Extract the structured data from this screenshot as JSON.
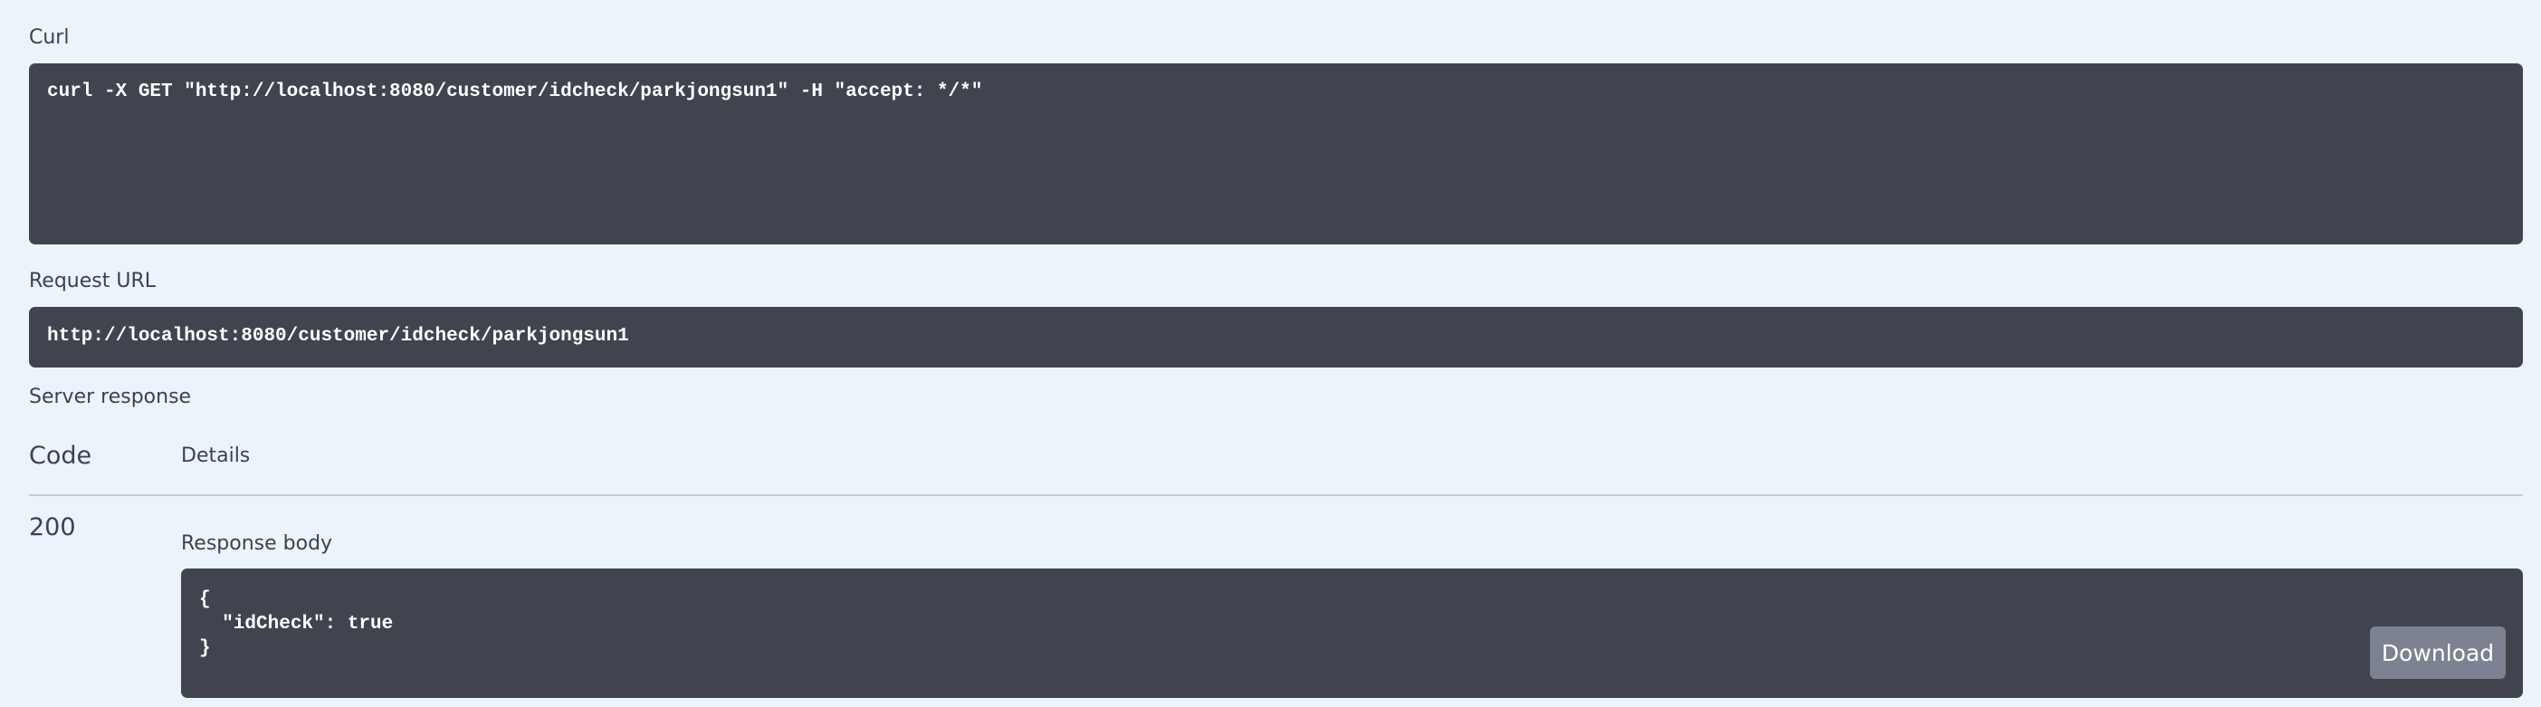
{
  "curl": {
    "label": "Curl",
    "command": "curl -X GET \"http://localhost:8080/customer/idcheck/parkjongsun1\" -H \"accept: */*\""
  },
  "request_url": {
    "label": "Request URL",
    "value": "http://localhost:8080/customer/idcheck/parkjongsun1"
  },
  "server_response": {
    "label": "Server response",
    "columns": {
      "code": "Code",
      "details": "Details"
    },
    "row": {
      "code": "200",
      "body_label": "Response body",
      "body_lines": [
        "{",
        "  \"idCheck\": true",
        "}"
      ],
      "download_label": "Download"
    }
  },
  "colors": {
    "background": "#ebf3fb",
    "code_block": "#41444e",
    "download_button": "#7d8293",
    "text": "#3b4151"
  }
}
